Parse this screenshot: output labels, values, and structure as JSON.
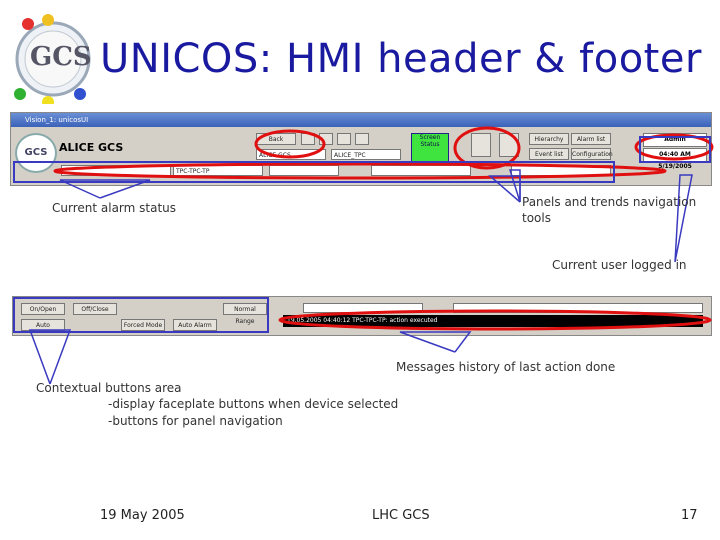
{
  "title": "UNICOS: HMI header & footer",
  "logo_text": "GCS",
  "header": {
    "window_title": "Vision_1: unicosUI",
    "app_name": "ALICE GCS",
    "logo_text": "GCS",
    "back_label": "Back",
    "green_box_label": "Screen Status",
    "panel_buttons": [
      "Hierarchy",
      "Alarm list",
      "Event list",
      "Configuration"
    ],
    "user_label": "Admin",
    "time_label": "04:40 AM 5/19/2005",
    "fields": [
      "ALICE GCS",
      "ALICE_TPC",
      "...",
      "TPC-TPC-TP"
    ]
  },
  "footer": {
    "buttons": [
      "On/Open",
      "Off/Close",
      "Auto",
      "Forced Mode",
      "Auto Alarm",
      "Normal Range"
    ],
    "message": "19.05.2005 04:40:12 TPC-TPC-TP: action executed"
  },
  "annotations": {
    "alarm_status": "Current alarm status",
    "panels_trends_1": "Panels and trends navigation",
    "panels_trends_2": "tools",
    "current_user": "Current user logged in",
    "messages_history": "Messages history of last action done",
    "contextual_1": "Contextual buttons area",
    "contextual_2": "-display faceplate buttons when device selected",
    "contextual_3": "-buttons for panel navigation"
  },
  "slide_footer": {
    "date": "19 May 2005",
    "center": "LHC GCS",
    "page": "17"
  },
  "colors": {
    "title": "#1a1aa0",
    "red_highlight": "#e01010",
    "blue_highlight": "#3a3ac0"
  }
}
